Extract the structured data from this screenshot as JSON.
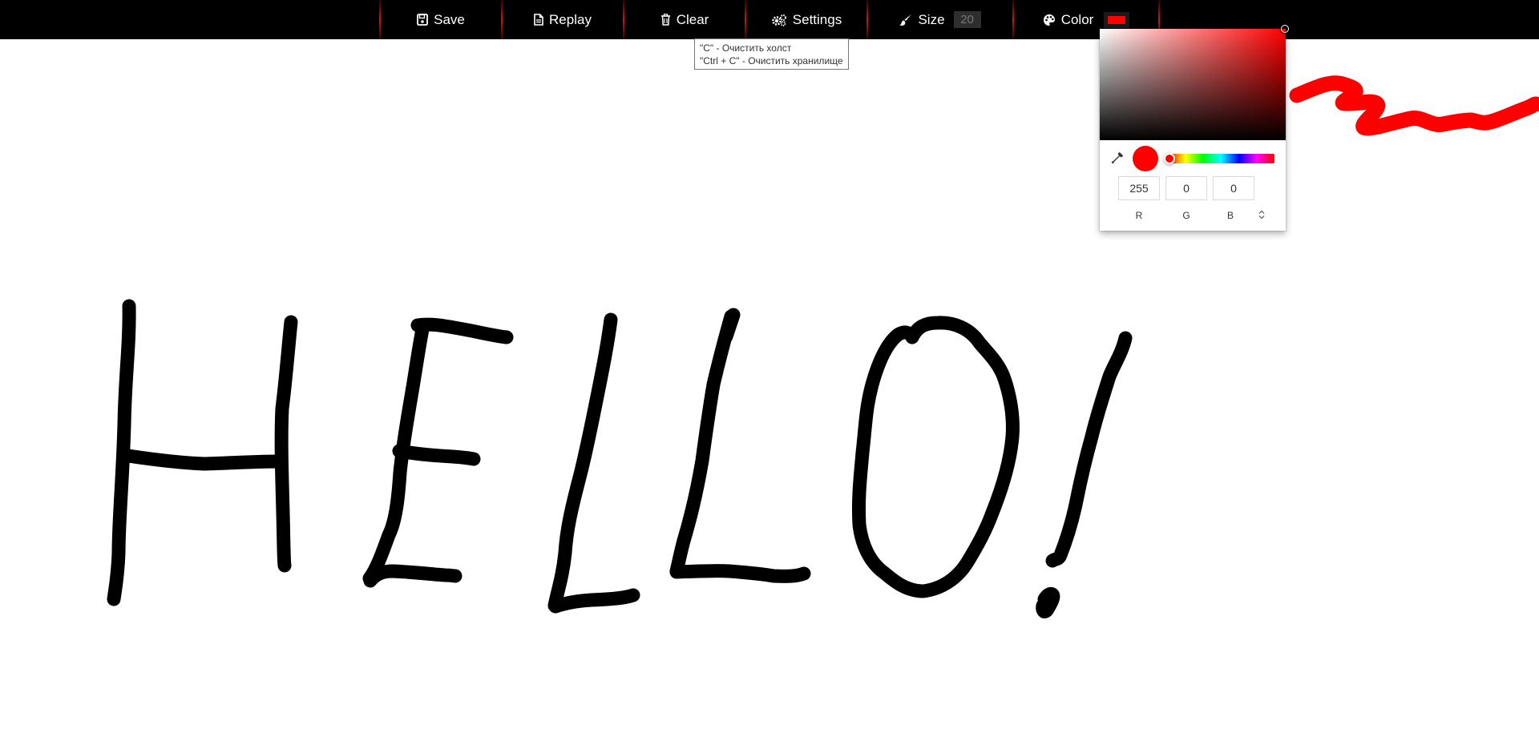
{
  "toolbar": {
    "save_label": "Save",
    "replay_label": "Replay",
    "clear_label": "Clear",
    "settings_label": "Settings",
    "size_label": "Size",
    "size_value": "20",
    "color_label": "Color",
    "current_color": "#ff0000"
  },
  "tooltip": {
    "line1": "\"C\" - Очистить холст",
    "line2": "\"Ctrl + C\" - Очистить хранилище"
  },
  "color_picker": {
    "hue_color": "#ff0000",
    "preview_color": "#ff0000",
    "r_value": "255",
    "g_value": "0",
    "b_value": "0",
    "r_label": "R",
    "g_label": "G",
    "b_label": "B"
  },
  "canvas": {
    "ink_color": "#000000",
    "stroke_color_red": "#ff0000"
  },
  "icons": {
    "save": "floppy-disk-icon",
    "replay": "file-icon",
    "clear": "trash-icon",
    "settings": "gears-icon",
    "size": "paintbrush-icon",
    "color": "palette-icon",
    "eyedropper": "eyedropper-icon"
  }
}
